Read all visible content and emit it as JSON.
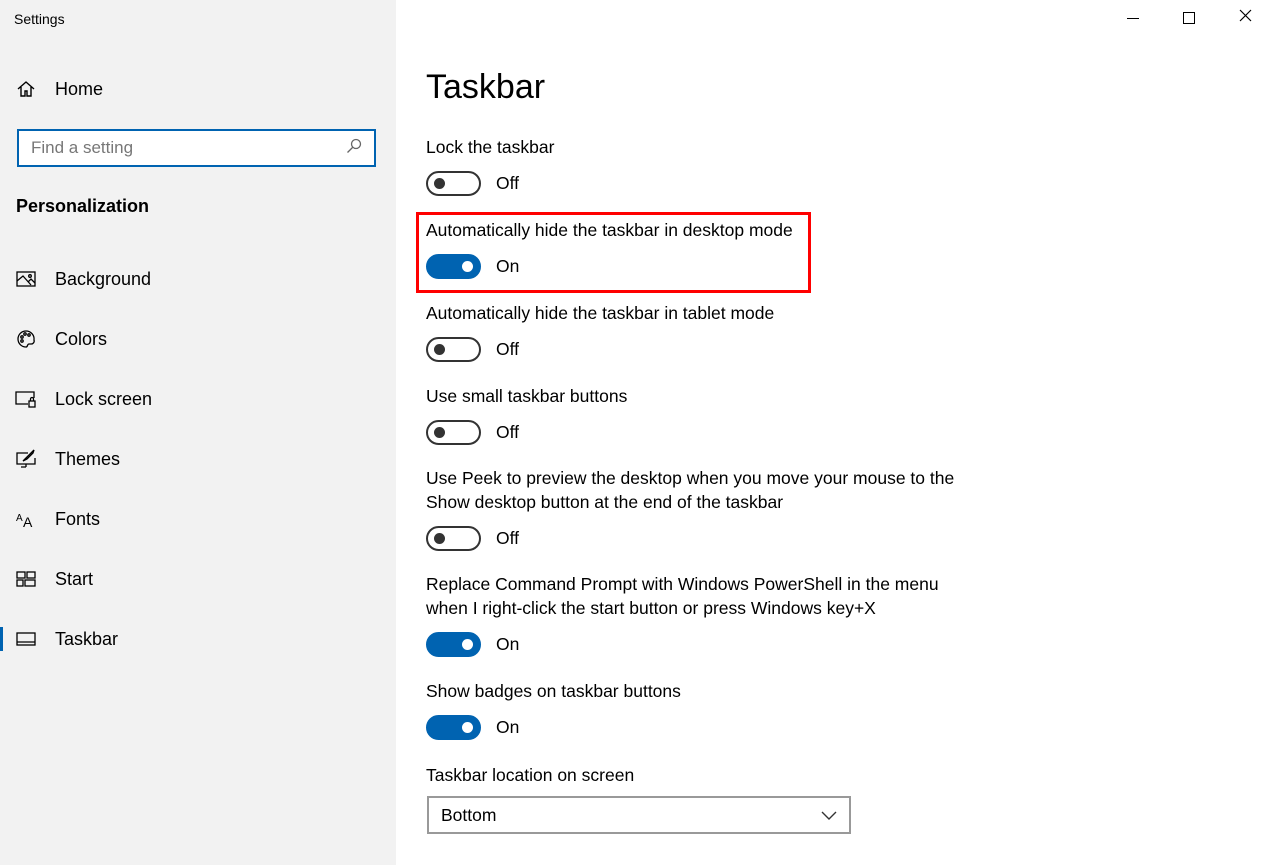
{
  "window": {
    "title": "Settings"
  },
  "sidebar": {
    "home": "Home",
    "search_placeholder": "Find a setting",
    "section": "Personalization",
    "items": [
      {
        "label": "Background",
        "icon": "image-icon"
      },
      {
        "label": "Colors",
        "icon": "palette-icon"
      },
      {
        "label": "Lock screen",
        "icon": "lock-screen-icon"
      },
      {
        "label": "Themes",
        "icon": "themes-icon"
      },
      {
        "label": "Fonts",
        "icon": "fonts-icon"
      },
      {
        "label": "Start",
        "icon": "start-icon"
      },
      {
        "label": "Taskbar",
        "icon": "taskbar-icon",
        "selected": true
      }
    ]
  },
  "main": {
    "title": "Taskbar",
    "settings": [
      {
        "label": "Lock the taskbar",
        "state": "Off",
        "on": false
      },
      {
        "label": "Automatically hide the taskbar in desktop mode",
        "state": "On",
        "on": true,
        "highlighted": true
      },
      {
        "label": "Automatically hide the taskbar in tablet mode",
        "state": "Off",
        "on": false
      },
      {
        "label": "Use small taskbar buttons",
        "state": "Off",
        "on": false
      },
      {
        "label": "Use Peek to preview the desktop when you move your mouse to the",
        "label2": "Show desktop button at the end of the taskbar",
        "state": "Off",
        "on": false
      },
      {
        "label": "Replace Command Prompt with Windows PowerShell in the menu",
        "label2": "when I right-click the start button or press Windows key+X",
        "state": "On",
        "on": true
      },
      {
        "label": "Show badges on taskbar buttons",
        "state": "On",
        "on": true
      }
    ],
    "location": {
      "label": "Taskbar location on screen",
      "value": "Bottom"
    }
  },
  "colors": {
    "accent": "#0063b1",
    "highlight": "#ff0000"
  }
}
